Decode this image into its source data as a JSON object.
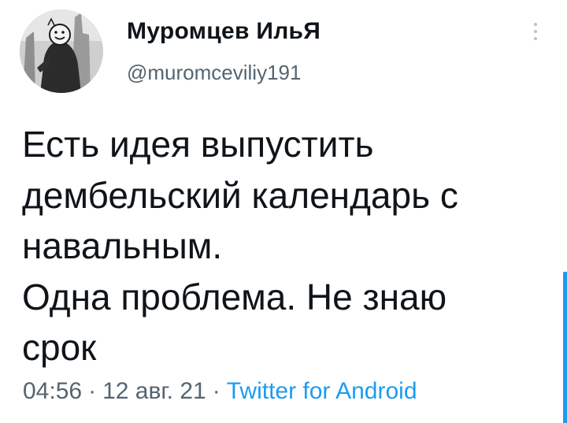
{
  "author": {
    "display_name": "Муромцев ИльЯ",
    "username": "@muromceviliy191"
  },
  "more_icon": "vertical-ellipsis-icon",
  "avatar_icon": "person-photo-with-smiley-avatar",
  "tweet": {
    "text": "Есть идея выпустить\nдембельский календарь с\nнавальным.\nОдна проблема. Не знаю\nсрок"
  },
  "meta": {
    "time": "04:56",
    "separator": "·",
    "date": "12 авг. 21",
    "source": "Twitter for Android"
  },
  "colors": {
    "text": "#0f1419",
    "secondary": "#536471",
    "link": "#1d9bf0",
    "background": "#ffffff"
  }
}
